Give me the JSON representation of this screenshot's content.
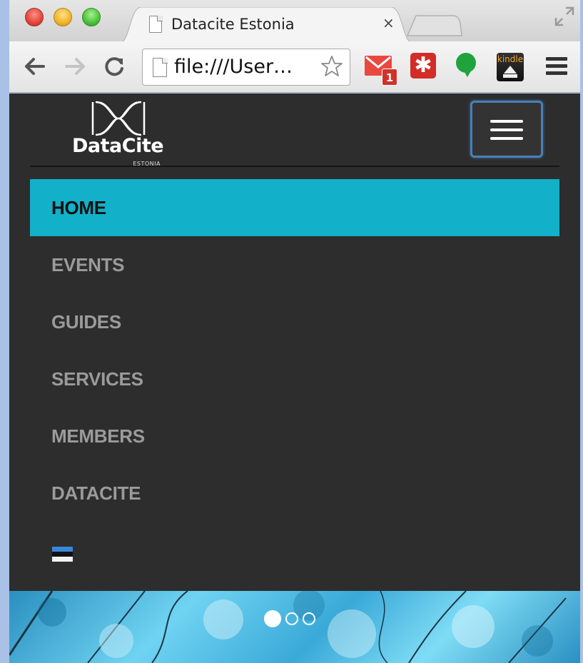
{
  "browser": {
    "tab": {
      "title": "Datacite Estonia",
      "close_glyph": "×"
    },
    "address": {
      "text": "file:///User…"
    },
    "icons": {
      "back": "arrow-left-icon",
      "forward": "arrow-right-icon",
      "reload": "reload-icon",
      "bookmark": "star-icon",
      "menu": "hamburger-menu-icon"
    },
    "extensions": {
      "gmail_badge": "1",
      "lastpass_glyph": "✱",
      "kindle_label": "kindle"
    }
  },
  "site": {
    "logo": {
      "name": "DataCite",
      "sub": "ESTONIA"
    },
    "nav": {
      "items": [
        {
          "label": "HOME",
          "active": true
        },
        {
          "label": "EVENTS",
          "active": false
        },
        {
          "label": "GUIDES",
          "active": false
        },
        {
          "label": "SERVICES",
          "active": false
        },
        {
          "label": "MEMBERS",
          "active": false
        },
        {
          "label": "DATACITE",
          "active": false
        }
      ],
      "language_flag": {
        "name": "estonia-flag-icon",
        "colors": [
          "#0072ce",
          "#000000",
          "#ffffff"
        ]
      }
    },
    "carousel": {
      "slides": 3,
      "active_index": 0
    },
    "colors": {
      "active_nav": "#12b0c9",
      "nav_background": "#2d2d2d",
      "nav_text": "#9b9b9b"
    }
  }
}
